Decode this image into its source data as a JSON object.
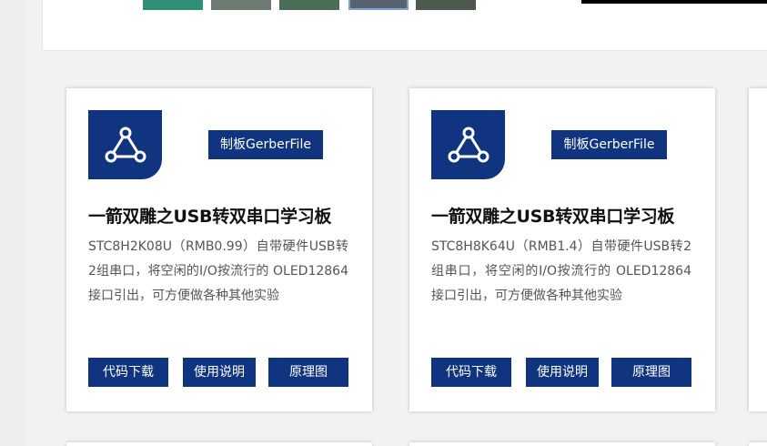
{
  "colors": {
    "accent": "#10347f",
    "background": "#f2f2f2",
    "card": "#ffffff"
  },
  "cards": [
    {
      "icon": "share-nodes-icon",
      "tag_label": "制板GerberFile",
      "title": "一箭双雕之USB转双串口学习板",
      "description": "STC8H2K08U（RMB0.99）自带硬件USB转2组串口，将空闲的I/O按流行的 OLED12864接口引出，可方便做各种其他实验",
      "buttons": [
        "代码下载",
        "使用说明",
        "原理图"
      ]
    },
    {
      "icon": "share-nodes-icon",
      "tag_label": "制板GerberFile",
      "title": "一箭双雕之USB转双串口学习板",
      "description": "STC8H8K64U（RMB1.4）自带硬件USB转2组串口，将空闲的I/O按流行的 OLED12864接口引出，可方便做各种其他实验",
      "buttons": [
        "代码下载",
        "使用说明",
        "原理图"
      ]
    }
  ]
}
